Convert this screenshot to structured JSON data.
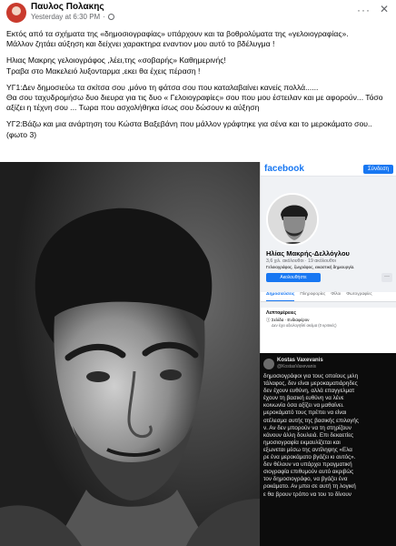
{
  "post": {
    "author": "Παυλος Πολακης",
    "timestamp": "Yesterday at 6:30 PM",
    "more_label": "···",
    "close_label": "✕",
    "paragraphs": [
      "Εκτός από τα σχήματα της «δημοσιογραφίας» υπάρχουν και τα βοθρολύματα της «γελοιογραφίας».\nΜάλλον ζητάει αύξηση και δείχνει χαρακτηρα εναντιον μου αυτό το βδέλυγμα !",
      "Ηλιας Μακρης γελοιογράφος ,λέει,της «σοβαρής» Καθημερινής!\nΤραβα στο Μακελειό  λυξονταρμα ,εκει θα έχεις πέραση !",
      "ΥΓ1:Δεν δημοσιεύω τα σκίτσα σου ,μόνο τη φάτσα σου που καταλαβαίνει κανείς πολλά......\nΘα σου ταχυδρομήσω δυο διευρα για τις δυο « Γελοιογραφίες» σου που μου έστειλαν και με αφορούν... Τόσο αξίζει η τέχνη σου ... Τωρα που ασχολήθηκα ίσως σου δώσουν κι αύξηση",
      "ΥΓ2:Βάζω και μια ανάρτηση του Κώστα Βαξεβάνη που μάλλον γράφτηκε για σένα και το μεροκάματο σου..(φωτο 3)"
    ]
  },
  "fb_profile": {
    "logo": "facebook",
    "login_label": "Σύνδεση",
    "name": "Ηλίας Μακρής-Δελλόγλου",
    "stats": "3,6 χιλ. ακόλουθοι · 19 ακόλουθοι",
    "description": "Γελοιογράφος, ζωγράφος, εικαστική δημιουργία.",
    "follow_label": "Ακολουθήστε",
    "dots_label": "···",
    "tabs": [
      "Δημοσιεύσεις",
      "Πληροφορίες",
      "Φίλοι",
      "Φωτογραφίες"
    ],
    "info_title": "Λεπτομέρειες",
    "info_line": "Σελίδα · Ενδιαφέρον",
    "info_sub": "Δεν έχει αξιολογηθεί ακόμα (0 κριτικές)"
  },
  "tweet": {
    "name": "Kostas Vaxevanis",
    "handle": "@KostasVaxevanis",
    "body": "δημοσιογράφοι για τους οποίους μιλη\nτάλαφος, δεν είναι μεροκαματιάρηδες\nδεν έχουν ευθύνη, αλλά επαγγελματ\nέχουν τη βασική ευθύνη να λένε\nκοινωνία όσα αξίζει να μαθαίνει.\nμεροκάματό τους πρέπει να είναι\nοτέλεσμα αυτής της βασικής επιλογής\nν. Αν δεν μπορούν να τη στηρίζουν\nκάνουν άλλη δουλειά. Επι δεκαετίες\nημοσιογραφία εκμαυλίζεται και\nεξωνεται μέσω της αντίληψης «Ελα\nρε ένα μεροκάματο βγάζει κι αυτός».\nδεν θέλουν να υπάρχει πραγματική\nσιογραφία επιθυμούν αυτό ακριβώς\nτον δημοσιογράφο, να βγάζει ένα\nροκάματο. Αν μπει σε αυτή τη λογική\nε θα βρουν τρόπο να του το δίνουν"
  }
}
